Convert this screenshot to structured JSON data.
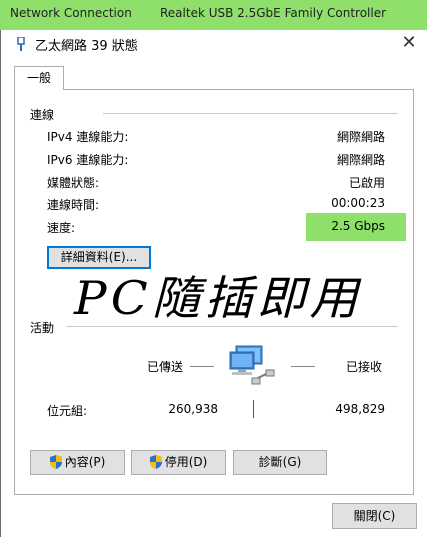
{
  "top_bar": {
    "left_text": "Network Connection",
    "right_text": "Realtek USB 2.5GbE Family Controller"
  },
  "window": {
    "title": "乙太網路 39 狀態",
    "close_glyph": "✕"
  },
  "tab": {
    "label": "一般"
  },
  "connection": {
    "heading": "連線",
    "rows": [
      {
        "label": "IPv4 連線能力:",
        "value": "網際網路"
      },
      {
        "label": "IPv6 連線能力:",
        "value": "網際網路"
      },
      {
        "label": "媒體狀態:",
        "value": "已啟用"
      },
      {
        "label": "連線時間:",
        "value": "00:00:23"
      },
      {
        "label": "速度:",
        "value": "2.5 Gbps"
      }
    ],
    "details_button": "詳細資料(E)..."
  },
  "handwriting": "PC隨插即用",
  "activity": {
    "heading": "活動",
    "sent_label": "已傳送",
    "received_label": "已接收",
    "bytes_label": "位元組:",
    "bytes_sent": "260,938",
    "bytes_received": "498,829"
  },
  "buttons": {
    "properties": "內容(P)",
    "disable": "停用(D)",
    "diagnose": "診斷(G)",
    "close": "關閉(C)"
  },
  "colors": {
    "highlight": "#8ee06a",
    "focus_border": "#0078d7"
  }
}
